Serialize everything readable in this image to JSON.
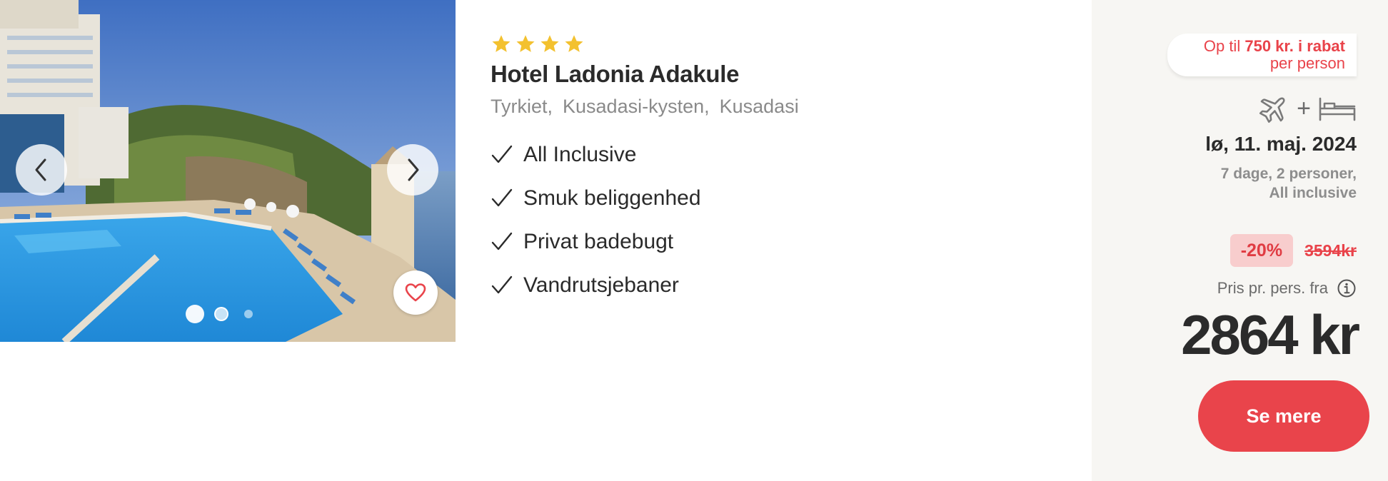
{
  "hotel": {
    "stars": 4,
    "name": "Hotel Ladonia Adakule",
    "location": [
      "Tyrkiet,",
      "Kusadasi-kysten,",
      "Kusadasi"
    ],
    "features": [
      "All Inclusive",
      "Smuk beliggenhed",
      "Privat badebugt",
      "Vandrutsjebaner"
    ]
  },
  "gallery": {
    "prev_icon": "chevron-left-icon",
    "next_icon": "chevron-right-icon",
    "favorite_icon": "heart-icon",
    "slides_total": 3,
    "active_slide": 1
  },
  "offer": {
    "promo_prefix": "Op til",
    "promo_amount": "750 kr. i rabat",
    "promo_suffix": "per person",
    "travel_icons": [
      "plane-icon",
      "bed-icon"
    ],
    "travel_plus": "+",
    "date": "lø, 11. maj. 2024",
    "details_line1": "7 dage, 2 personer,",
    "details_line2": "All inclusive",
    "discount": "-20%",
    "old_price": "3594kr",
    "price_label": "Pris pr. pers. fra",
    "info_icon": "info-icon",
    "price": "2864 kr",
    "cta": "Se mere"
  },
  "colors": {
    "accent": "#e9444b",
    "star": "#f3c12f",
    "panel_bg": "#f7f6f3",
    "discount_bg": "#f8cdcd"
  }
}
